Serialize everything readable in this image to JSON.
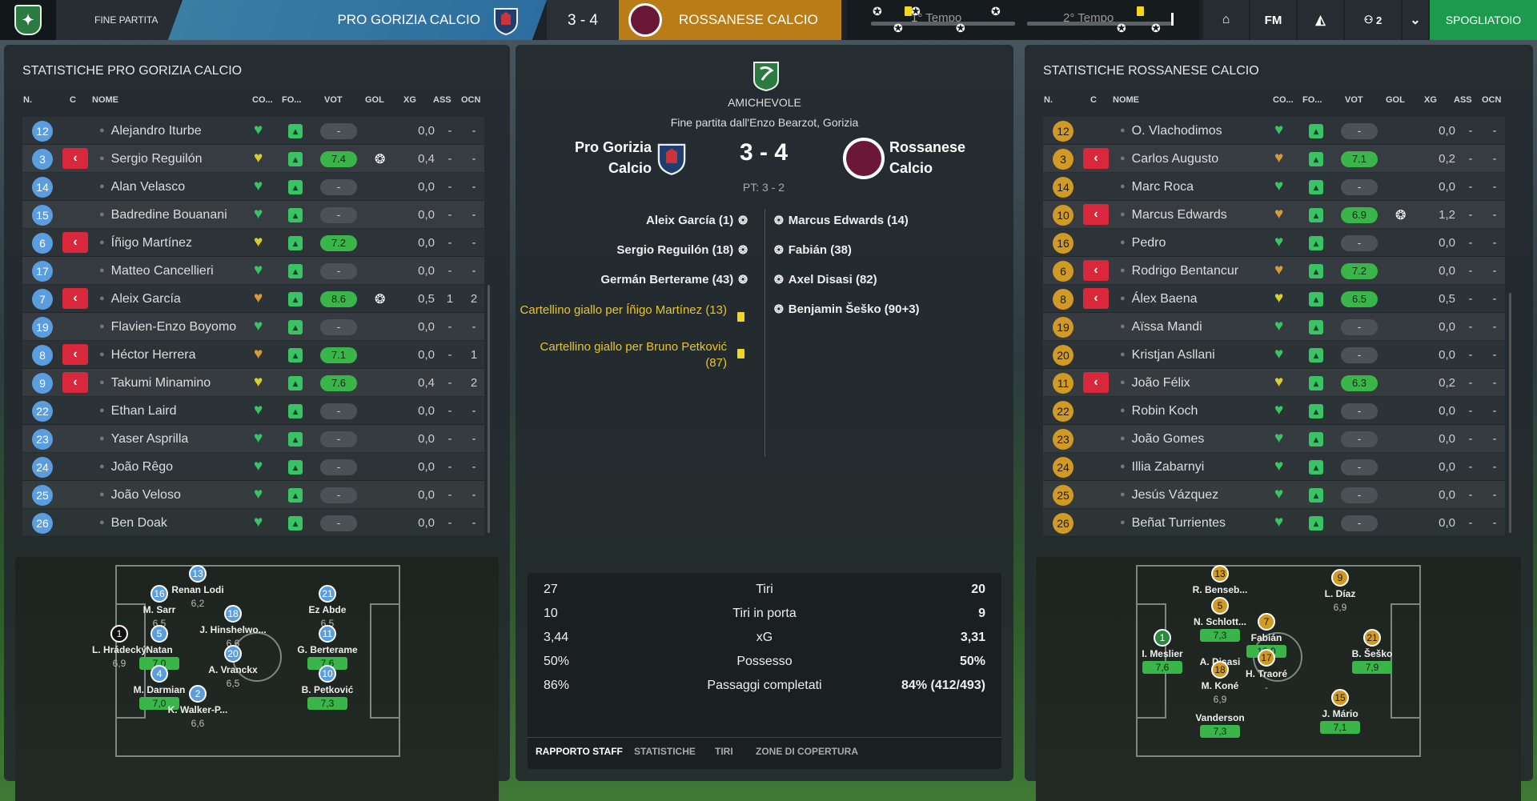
{
  "topbar": {
    "fine_partita": "FINE PARTITA",
    "home_team": "PRO GORIZIA CALCIO",
    "score": "3 - 4",
    "away_team": "ROSSANESE CALCIO",
    "first_half": "1° Tempo",
    "second_half": "2° Tempo",
    "fm_label": "FM",
    "people_count": "2",
    "spogliatoio": "SPOGLIATOIO"
  },
  "colors": {
    "home": "#3b7ea3",
    "away": "#b97c16",
    "accent": "#1e9a4e",
    "card": "#d9283c",
    "rating_good": "#3ab54a"
  },
  "headers": {
    "n": "N.",
    "c": "C",
    "nome": "NOME",
    "co": "CO...",
    "fo": "FO...",
    "vot": "VOT",
    "gol": "GOL",
    "xg": "XG",
    "ass": "ASS",
    "ocn": "OCN"
  },
  "left": {
    "title": "STATISTICHE PRO GORIZIA CALCIO",
    "rows": [
      {
        "n": "12",
        "cap": false,
        "name": "Alejandro Iturbe",
        "cond": "green",
        "vot": "-",
        "gol": false,
        "xg": "0,0",
        "ass": "-",
        "ocn": "-"
      },
      {
        "n": "3",
        "cap": true,
        "name": "Sergio Reguilón",
        "cond": "yellow",
        "vot": "7.4",
        "gol": true,
        "xg": "0,4",
        "ass": "-",
        "ocn": "-"
      },
      {
        "n": "14",
        "cap": false,
        "name": "Alan Velasco",
        "cond": "green",
        "vot": "-",
        "gol": false,
        "xg": "0,0",
        "ass": "-",
        "ocn": "-"
      },
      {
        "n": "15",
        "cap": false,
        "name": "Badredine Bouanani",
        "cond": "green",
        "vot": "-",
        "gol": false,
        "xg": "0,0",
        "ass": "-",
        "ocn": "-"
      },
      {
        "n": "6",
        "cap": true,
        "name": "Íñigo Martínez",
        "cond": "yellow",
        "vot": "7.2",
        "gol": false,
        "xg": "0,0",
        "ass": "-",
        "ocn": "-"
      },
      {
        "n": "17",
        "cap": false,
        "name": "Matteo Cancellieri",
        "cond": "green",
        "vot": "-",
        "gol": false,
        "xg": "0,0",
        "ass": "-",
        "ocn": "-"
      },
      {
        "n": "7",
        "cap": true,
        "name": "Aleix García",
        "cond": "orange",
        "vot": "8.6",
        "gol": true,
        "xg": "0,5",
        "ass": "1",
        "ocn": "2"
      },
      {
        "n": "19",
        "cap": false,
        "name": "Flavien-Enzo Boyomo",
        "cond": "green",
        "vot": "-",
        "gol": false,
        "xg": "0,0",
        "ass": "-",
        "ocn": "-"
      },
      {
        "n": "8",
        "cap": true,
        "name": "Héctor Herrera",
        "cond": "orange",
        "vot": "7.1",
        "gol": false,
        "xg": "0,0",
        "ass": "-",
        "ocn": "1"
      },
      {
        "n": "9",
        "cap": true,
        "name": "Takumi Minamino",
        "cond": "yellow",
        "vot": "7.6",
        "gol": false,
        "xg": "0,4",
        "ass": "-",
        "ocn": "2"
      },
      {
        "n": "22",
        "cap": false,
        "name": "Ethan Laird",
        "cond": "green",
        "vot": "-",
        "gol": false,
        "xg": "0,0",
        "ass": "-",
        "ocn": "-"
      },
      {
        "n": "23",
        "cap": false,
        "name": "Yaser Asprilla",
        "cond": "green",
        "vot": "-",
        "gol": false,
        "xg": "0,0",
        "ass": "-",
        "ocn": "-"
      },
      {
        "n": "24",
        "cap": false,
        "name": "João Rêgo",
        "cond": "green",
        "vot": "-",
        "gol": false,
        "xg": "0,0",
        "ass": "-",
        "ocn": "-"
      },
      {
        "n": "25",
        "cap": false,
        "name": "João Veloso",
        "cond": "green",
        "vot": "-",
        "gol": false,
        "xg": "0,0",
        "ass": "-",
        "ocn": "-"
      },
      {
        "n": "26",
        "cap": false,
        "name": "Ben Doak",
        "cond": "green",
        "vot": "-",
        "gol": false,
        "xg": "0,0",
        "ass": "-",
        "ocn": "-"
      }
    ],
    "formation": [
      {
        "n": "13",
        "name": "Renan Lodi",
        "rating": "6,2",
        "style": "",
        "color": "blue"
      },
      {
        "n": "16",
        "name": "M. Sarr",
        "rating": "6,5",
        "style": "",
        "color": "blue"
      },
      {
        "n": "5",
        "name": "Natan",
        "rating": "7,0",
        "style": "g",
        "color": "blue"
      },
      {
        "n": "1",
        "name": "L. Hrádecký",
        "rating": "6,9",
        "style": "",
        "color": "black"
      },
      {
        "n": "4",
        "name": "M. Darmian",
        "rating": "7,0",
        "style": "g",
        "color": "blue"
      },
      {
        "n": "2",
        "name": "K. Walker-P...",
        "rating": "6,6",
        "style": "",
        "color": "blue"
      },
      {
        "n": "18",
        "name": "J. Hinshelwo...",
        "rating": "6,6",
        "style": "",
        "color": "blue"
      },
      {
        "n": "20",
        "name": "A. Vranckx",
        "rating": "6,5",
        "style": "",
        "color": "blue"
      },
      {
        "n": "21",
        "name": "Ez Abde",
        "rating": "6,5",
        "style": "",
        "color": "blue"
      },
      {
        "n": "11",
        "name": "G. Berterame",
        "rating": "7,6",
        "style": "g",
        "color": "blue"
      },
      {
        "n": "10",
        "name": "B. Petković",
        "rating": "7,3",
        "style": "g",
        "color": "blue"
      }
    ]
  },
  "center": {
    "competition": "AMICHEVOLE",
    "venue": "Fine partita dall'Enzo Bearzot, Gorizia",
    "home_line1": "Pro Gorizia",
    "home_line2": "Calcio",
    "away_line1": "Rossanese",
    "away_line2": "Calcio",
    "score": "3 - 4",
    "pt": "PT: 3 - 2",
    "home_events": [
      {
        "text": "Aleix García (1)",
        "type": "goal"
      },
      {
        "text": "Sergio Reguilón (18)",
        "type": "goal"
      },
      {
        "text": "Germán Berterame (43)",
        "type": "goal"
      },
      {
        "text": "Cartellino giallo per Íñigo Martínez (13)",
        "type": "yellow"
      },
      {
        "text": "Cartellino giallo per Bruno Petković (87)",
        "type": "yellow"
      }
    ],
    "away_events": [
      {
        "text": "Marcus Edwards (14)"
      },
      {
        "text": "Fabián (38)"
      },
      {
        "text": "Axel Disasi (82)"
      },
      {
        "text": "Benjamin Šeško (90+3)"
      }
    ],
    "stats": [
      {
        "home": "27",
        "label": "Tiri",
        "away": "20"
      },
      {
        "home": "10",
        "label": "Tiri in porta",
        "away": "9"
      },
      {
        "home": "3,44",
        "label": "xG",
        "away": "3,31"
      },
      {
        "home": "50%",
        "label": "Possesso",
        "away": "50%"
      },
      {
        "home": "86%",
        "label": "Passaggi completati",
        "away": "84% (412/493)"
      }
    ],
    "tabs": [
      "RAPPORTO STAFF",
      "STATISTICHE",
      "TIRI",
      "ZONE DI COPERTURA"
    ]
  },
  "right": {
    "title": "STATISTICHE ROSSANESE CALCIO",
    "rows": [
      {
        "n": "12",
        "cap": false,
        "name": "O. Vlachodimos",
        "cond": "green",
        "vot": "-",
        "gol": false,
        "xg": "0,0",
        "ass": "-",
        "ocn": "-"
      },
      {
        "n": "3",
        "cap": true,
        "name": "Carlos Augusto",
        "cond": "orange",
        "vot": "7.1",
        "gol": false,
        "xg": "0,2",
        "ass": "-",
        "ocn": "-"
      },
      {
        "n": "14",
        "cap": false,
        "name": "Marc Roca",
        "cond": "green",
        "vot": "-",
        "gol": false,
        "xg": "0,0",
        "ass": "-",
        "ocn": "-"
      },
      {
        "n": "10",
        "cap": true,
        "name": "Marcus Edwards",
        "cond": "orange",
        "vot": "6.9",
        "gol": true,
        "xg": "1,2",
        "ass": "-",
        "ocn": "-"
      },
      {
        "n": "16",
        "cap": false,
        "name": "Pedro",
        "cond": "green",
        "vot": "-",
        "gol": false,
        "xg": "0,0",
        "ass": "-",
        "ocn": "-"
      },
      {
        "n": "6",
        "cap": true,
        "name": "Rodrigo Bentancur",
        "cond": "orange",
        "vot": "7.2",
        "gol": false,
        "xg": "0,0",
        "ass": "-",
        "ocn": "-"
      },
      {
        "n": "8",
        "cap": true,
        "name": "Álex Baena",
        "cond": "yellow",
        "vot": "6.5",
        "gol": false,
        "xg": "0,5",
        "ass": "-",
        "ocn": "-"
      },
      {
        "n": "19",
        "cap": false,
        "name": "Aïssa Mandi",
        "cond": "green",
        "vot": "-",
        "gol": false,
        "xg": "0,0",
        "ass": "-",
        "ocn": "-"
      },
      {
        "n": "20",
        "cap": false,
        "name": "Kristjan Asllani",
        "cond": "green",
        "vot": "-",
        "gol": false,
        "xg": "0,0",
        "ass": "-",
        "ocn": "-"
      },
      {
        "n": "11",
        "cap": true,
        "name": "João Félix",
        "cond": "yellow",
        "vot": "6.3",
        "gol": false,
        "xg": "0,2",
        "ass": "-",
        "ocn": "-"
      },
      {
        "n": "22",
        "cap": false,
        "name": "Robin Koch",
        "cond": "green",
        "vot": "-",
        "gol": false,
        "xg": "0,0",
        "ass": "-",
        "ocn": "-"
      },
      {
        "n": "23",
        "cap": false,
        "name": "João Gomes",
        "cond": "green",
        "vot": "-",
        "gol": false,
        "xg": "0,0",
        "ass": "-",
        "ocn": "-"
      },
      {
        "n": "24",
        "cap": false,
        "name": "Illia Zabarnyi",
        "cond": "green",
        "vot": "-",
        "gol": false,
        "xg": "0,0",
        "ass": "-",
        "ocn": "-"
      },
      {
        "n": "25",
        "cap": false,
        "name": "Jesús Vázquez",
        "cond": "green",
        "vot": "-",
        "gol": false,
        "xg": "0,0",
        "ass": "-",
        "ocn": "-"
      },
      {
        "n": "26",
        "cap": false,
        "name": "Beñat Turrientes",
        "cond": "green",
        "vot": "-",
        "gol": false,
        "xg": "0,0",
        "ass": "-",
        "ocn": "-"
      }
    ],
    "formation": [
      {
        "n": "13",
        "name": "R. Benseb...",
        "rating": "",
        "style": "",
        "color": "gold"
      },
      {
        "n": "5",
        "name": "N. Schlott...",
        "rating": "7,3",
        "style": "g",
        "color": "gold"
      },
      {
        "n": "1",
        "name": "I. Meslier",
        "rating": "7,6",
        "style": "g",
        "color": "green"
      },
      {
        "n": "7",
        "name": "Fabián",
        "rating": "10,0",
        "style": "g",
        "color": "gold"
      },
      {
        "n": "17",
        "name": "H. Traoré",
        "rating": "-",
        "style": "",
        "color": "gold"
      },
      {
        "n": "A",
        "name": "A. Disasi",
        "rating": "",
        "style": "",
        "color": "none"
      },
      {
        "n": "18",
        "name": "M. Koné",
        "rating": "6,9",
        "style": "",
        "color": "gold"
      },
      {
        "n": "",
        "name": "Vanderson",
        "rating": "7,3",
        "style": "g",
        "color": "none"
      },
      {
        "n": "9",
        "name": "L. Díaz",
        "rating": "6,9",
        "style": "",
        "color": "gold"
      },
      {
        "n": "21",
        "name": "B. Šeško",
        "rating": "7,9",
        "style": "g",
        "color": "gold"
      },
      {
        "n": "15",
        "name": "J. Mário",
        "rating": "7,1",
        "style": "g",
        "color": "gold"
      }
    ]
  }
}
